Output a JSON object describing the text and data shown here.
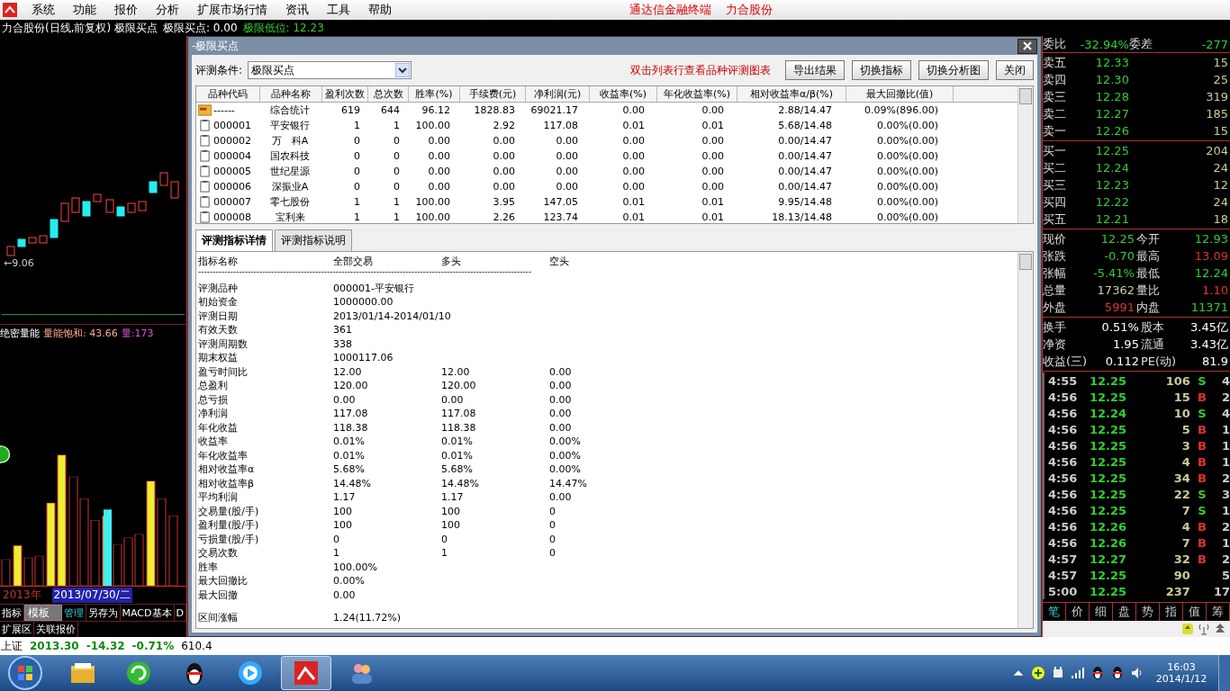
{
  "menu": {
    "items": [
      "系统",
      "功能",
      "报价",
      "分析",
      "扩展市场行情",
      "资讯",
      "工具",
      "帮助"
    ],
    "links": [
      "通达信金融终端",
      "力合股份"
    ]
  },
  "chart_title": {
    "stock": "力合股份(日线,前复权) 极限买点",
    "indicator": "极限买点: 0.00",
    "low": "极限低位: 12.23"
  },
  "left_panel": {
    "price_marker": "←9.06",
    "volume_indicator": {
      "name": "绝密量能",
      "reading": "量能饱和: 43.66",
      "volume": "量:173"
    },
    "year": "2013年",
    "date": "2013/07/30/二",
    "toolbar": [
      {
        "label": "指标",
        "selected": false,
        "highlight": false
      },
      {
        "label": "模板",
        "selected": true,
        "highlight": false
      },
      {
        "label": "管理",
        "selected": false,
        "highlight": true
      },
      {
        "label": "另存为",
        "selected": false,
        "highlight": false
      },
      {
        "label": "MACD基本",
        "selected": false,
        "highlight": false
      },
      {
        "label": "D",
        "selected": false,
        "highlight": false
      }
    ],
    "toolbar2": [
      "扩展区",
      "关联报价"
    ]
  },
  "status_bar": {
    "index": "上证",
    "value": "2013.30",
    "change": "-14.32",
    "percent": "-0.71%",
    "amount": "610.4"
  },
  "dialog": {
    "title": "-极限买点",
    "condition_label": "评测条件:",
    "condition_value": "极限买点",
    "hint": "双击列表行查看品种评测图表",
    "buttons": [
      "导出结果",
      "切换指标",
      "切换分析图",
      "关闭"
    ],
    "table": {
      "columns": [
        "品种代码",
        "品种名称",
        "盈利次数",
        "总次数",
        "胜率(%)",
        "手续费(元)",
        "净利润(元)",
        "收益率(%)",
        "年化收益率(%)",
        "相对收益率α/β(%)",
        "最大回撤比(值)"
      ],
      "rows": [
        {
          "kind": "summary",
          "cells": [
            "------",
            "综合统计",
            "619",
            "644",
            "96.12",
            "1828.83",
            "69021.17",
            "0.00",
            "0.00",
            "2.88/14.47",
            "0.09%(896.00)"
          ]
        },
        {
          "kind": "stock",
          "cells": [
            "000001",
            "平安银行",
            "1",
            "1",
            "100.00",
            "2.92",
            "117.08",
            "0.01",
            "0.01",
            "5.68/14.48",
            "0.00%(0.00)"
          ]
        },
        {
          "kind": "stock",
          "cells": [
            "000002",
            "万　科A",
            "0",
            "0",
            "0.00",
            "0.00",
            "0.00",
            "0.00",
            "0.00",
            "0.00/14.47",
            "0.00%(0.00)"
          ]
        },
        {
          "kind": "stock",
          "cells": [
            "000004",
            "国农科技",
            "0",
            "0",
            "0.00",
            "0.00",
            "0.00",
            "0.00",
            "0.00",
            "0.00/14.47",
            "0.00%(0.00)"
          ]
        },
        {
          "kind": "stock",
          "cells": [
            "000005",
            "世纪星源",
            "0",
            "0",
            "0.00",
            "0.00",
            "0.00",
            "0.00",
            "0.00",
            "0.00/14.47",
            "0.00%(0.00)"
          ]
        },
        {
          "kind": "stock",
          "cells": [
            "000006",
            "深振业A",
            "0",
            "0",
            "0.00",
            "0.00",
            "0.00",
            "0.00",
            "0.00",
            "0.00/14.47",
            "0.00%(0.00)"
          ]
        },
        {
          "kind": "stock",
          "cells": [
            "000007",
            "零七股份",
            "1",
            "1",
            "100.00",
            "3.95",
            "147.05",
            "0.01",
            "0.01",
            "9.95/14.48",
            "0.00%(0.00)"
          ]
        },
        {
          "kind": "stock",
          "cells": [
            "000008",
            "宝利来",
            "1",
            "1",
            "100.00",
            "2.26",
            "123.74",
            "0.01",
            "0.01",
            "18.13/14.48",
            "0.00%(0.00)"
          ]
        }
      ]
    },
    "tabs": [
      {
        "label": "评测指标详情",
        "selected": true
      },
      {
        "label": "评测指标说明",
        "selected": false
      }
    ],
    "details": {
      "headers": [
        "指标名称",
        "全部交易",
        "多头",
        "空头"
      ],
      "divider": "------------------------------------------------------------------------------------------------------------------",
      "rows": [
        [
          "评测品种",
          "000001-平安银行"
        ],
        [
          "初始资金",
          "1000000.00"
        ],
        [
          "评测日期",
          "2013/01/14-2014/01/10"
        ],
        [
          "有效天数",
          "361"
        ],
        [
          "评测周期数",
          "338"
        ],
        [
          "期末权益",
          "1000117.06"
        ],
        [
          "盈亏时间比",
          "12.00",
          "12.00",
          "0.00"
        ],
        [
          "总盈利",
          "120.00",
          "120.00",
          "0.00"
        ],
        [
          "总亏损",
          "0.00",
          "0.00",
          "0.00"
        ],
        [
          "净利润",
          "117.08",
          "117.08",
          "0.00"
        ],
        [
          "年化收益",
          "118.38",
          "118.38",
          "0.00"
        ],
        [
          "收益率",
          "0.01%",
          "0.01%",
          "0.00%"
        ],
        [
          "年化收益率",
          "0.01%",
          "0.01%",
          "0.00%"
        ],
        [
          "相对收益率α",
          "5.68%",
          "5.68%",
          "0.00%"
        ],
        [
          "相对收益率β",
          "14.48%",
          "14.48%",
          "14.47%"
        ],
        [
          "平均利润",
          "1.17",
          "1.17",
          "0.00"
        ],
        [
          "交易量(股/手)",
          "100",
          "100",
          "0"
        ],
        [
          "盈利量(股/手)",
          "100",
          "100",
          "0"
        ],
        [
          "亏损量(股/手)",
          "0",
          "0",
          "0"
        ],
        [
          "交易次数",
          "1",
          "1",
          "0"
        ],
        [
          "胜率",
          "100.00%"
        ],
        [
          "最大回撤比",
          "0.00%"
        ],
        [
          "最大回撤",
          "0.00"
        ]
      ],
      "extra_rows": [
        [
          "区间涨幅",
          "1.24(11.72%)"
        ]
      ]
    }
  },
  "quote": {
    "ratio": [
      "委比",
      "-32.94%",
      "委差",
      "-277"
    ],
    "asks": [
      {
        "label": "卖五",
        "price": "12.33",
        "volume": "15"
      },
      {
        "label": "卖四",
        "price": "12.30",
        "volume": "25"
      },
      {
        "label": "卖三",
        "price": "12.28",
        "volume": "319"
      },
      {
        "label": "卖二",
        "price": "12.27",
        "volume": "185"
      },
      {
        "label": "卖一",
        "price": "12.26",
        "volume": "15"
      }
    ],
    "bids": [
      {
        "label": "买一",
        "price": "12.25",
        "volume": "204"
      },
      {
        "label": "买二",
        "price": "12.24",
        "volume": "24"
      },
      {
        "label": "买三",
        "price": "12.23",
        "volume": "12"
      },
      {
        "label": "买四",
        "price": "12.22",
        "volume": "24"
      },
      {
        "label": "买五",
        "price": "12.21",
        "volume": "18"
      }
    ],
    "stats": [
      {
        "label": "现价",
        "value": "12.25",
        "color": "#33cc33"
      },
      {
        "label": "今开",
        "value": "12.93",
        "color": "#33cc33"
      },
      {
        "label": "张跌",
        "value": "-0.70",
        "color": "#33cc33"
      },
      {
        "label": "最高",
        "value": "13.09",
        "color": "#dd3333"
      },
      {
        "label": "张幅",
        "value": "-5.41%",
        "color": "#33cc33"
      },
      {
        "label": "最低",
        "value": "12.24",
        "color": "#33cc33"
      },
      {
        "label": "总量",
        "value": "17362",
        "color": "#cccc99"
      },
      {
        "label": "量比",
        "value": "1.10",
        "color": "#dd3333"
      },
      {
        "label": "外盘",
        "value": "5991",
        "color": "#dd3333"
      },
      {
        "label": "内盘",
        "value": "11371",
        "color": "#33cc33"
      }
    ],
    "stats2": [
      {
        "label": "换手",
        "value": "0.51%",
        "label2": "股本",
        "value2": "3.45亿"
      },
      {
        "label": "净资",
        "value": "1.95",
        "label2": "流通",
        "value2": "3.43亿"
      },
      {
        "label": "收益(三)",
        "value": "0.112",
        "label2": "PE(动)",
        "value2": "81.9"
      }
    ],
    "ticks": [
      {
        "time": "4:55",
        "price": "12.25",
        "volume": "106",
        "side": "S",
        "color": "#33cc33",
        "count": "4"
      },
      {
        "time": "4:56",
        "price": "12.25",
        "volume": "15",
        "side": "B",
        "color": "#dd3333",
        "count": "2"
      },
      {
        "time": "4:56",
        "price": "12.24",
        "volume": "10",
        "side": "S",
        "color": "#33cc33",
        "count": "4"
      },
      {
        "time": "4:56",
        "price": "12.25",
        "volume": "5",
        "side": "B",
        "color": "#dd3333",
        "count": "1"
      },
      {
        "time": "4:56",
        "price": "12.25",
        "volume": "3",
        "side": "B",
        "color": "#dd3333",
        "count": "1"
      },
      {
        "time": "4:56",
        "price": "12.25",
        "volume": "4",
        "side": "B",
        "color": "#dd3333",
        "count": "1"
      },
      {
        "time": "4:56",
        "price": "12.25",
        "volume": "34",
        "side": "B",
        "color": "#dd3333",
        "count": "2"
      },
      {
        "time": "4:56",
        "price": "12.25",
        "volume": "22",
        "side": "S",
        "color": "#33cc33",
        "count": "3"
      },
      {
        "time": "4:56",
        "price": "12.25",
        "volume": "7",
        "side": "S",
        "color": "#33cc33",
        "count": "1"
      },
      {
        "time": "4:56",
        "price": "12.26",
        "volume": "4",
        "side": "B",
        "color": "#dd3333",
        "count": "2"
      },
      {
        "time": "4:56",
        "price": "12.26",
        "volume": "7",
        "side": "B",
        "color": "#dd3333",
        "count": "1"
      },
      {
        "time": "4:57",
        "price": "12.27",
        "volume": "32",
        "side": "B",
        "color": "#dd3333",
        "count": "2"
      },
      {
        "time": "4:57",
        "price": "12.25",
        "volume": "90",
        "count": "5"
      },
      {
        "time": "5:00",
        "price": "12.25",
        "volume": "237",
        "count": "17"
      }
    ],
    "tabs": [
      {
        "label": "笔",
        "selected": true
      },
      {
        "label": "价",
        "selected": false
      },
      {
        "label": "细",
        "selected": false
      },
      {
        "label": "盘",
        "selected": false
      },
      {
        "label": "势",
        "selected": false
      },
      {
        "label": "指",
        "selected": false
      },
      {
        "label": "值",
        "selected": false
      },
      {
        "label": "筹",
        "selected": false
      }
    ]
  },
  "taskbar": {
    "apps": [
      {
        "kind": "folder",
        "selected": false
      },
      {
        "kind": "browser",
        "selected": false
      },
      {
        "kind": "penguin",
        "selected": false
      },
      {
        "kind": "player",
        "selected": false
      },
      {
        "kind": "stock",
        "selected": true
      },
      {
        "kind": "people",
        "selected": false
      }
    ],
    "time": "16:03",
    "date": "2014/1/12"
  }
}
